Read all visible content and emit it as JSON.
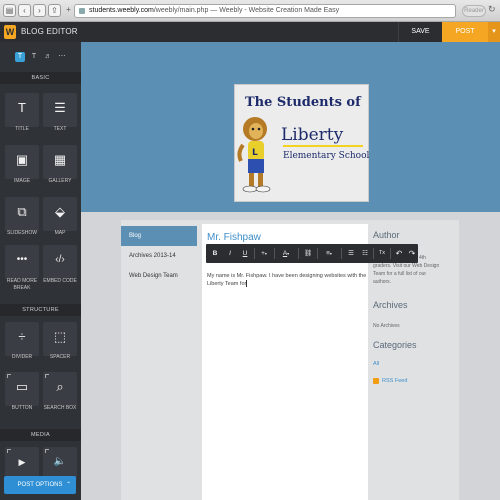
{
  "browser": {
    "url_host": "students.weebly.com",
    "url_path": "/weebly/main.php — Weebly - Website Creation Made Easy",
    "reader_label": "Reader"
  },
  "topbar": {
    "logo_letter": "W",
    "title": "BLOG EDITOR",
    "save_label": "SAVE",
    "post_label": "POST",
    "post_caret": "▾"
  },
  "sidebar": {
    "tabs": [
      {
        "label": "T",
        "active": true
      },
      {
        "label": "T",
        "active": false
      },
      {
        "label": "♬",
        "active": false
      },
      {
        "label": "⋯",
        "active": false
      }
    ],
    "sections": {
      "basic": "BASIC",
      "structure": "STRUCTURE",
      "media": "MEDIA"
    },
    "elements": [
      {
        "label": "TITLE",
        "icon": "T"
      },
      {
        "label": "TEXT",
        "icon": "☰"
      },
      {
        "label": "IMAGE",
        "icon": "▣"
      },
      {
        "label": "GALLERY",
        "icon": "▦"
      },
      {
        "label": "SLIDESHOW",
        "icon": "⧉"
      },
      {
        "label": "MAP",
        "icon": "⬙"
      },
      {
        "label": "READ MORE BREAK",
        "icon": "•••"
      },
      {
        "label": "EMBED CODE",
        "icon": "‹/›"
      },
      {
        "label": "DIVIDER",
        "icon": "÷"
      },
      {
        "label": "SPACER",
        "icon": "⬚"
      },
      {
        "label": "BUTTON",
        "icon": "▭"
      },
      {
        "label": "SEARCH BOX",
        "icon": "⌕"
      },
      {
        "label": "",
        "icon": "▶"
      },
      {
        "label": "",
        "icon": "🔈"
      }
    ],
    "post_options_label": "POST OPTIONS",
    "post_options_chevron": "⌃"
  },
  "site": {
    "banner": {
      "line1": "The Students of",
      "line2": "Liberty",
      "line3": "Elementary School"
    },
    "nav": [
      {
        "label": "Blog",
        "active": true
      },
      {
        "label": "Archives 2013-14",
        "active": false
      },
      {
        "label": "Web Design Team",
        "active": false
      }
    ],
    "post": {
      "title": "Mr. Fishpaw",
      "body": "My name is Mr. Fishpaw. I have been designing websites with the Liberty Team for"
    },
    "sidebar": {
      "author_heading": "Author",
      "author_text_top": "4th",
      "author_text": "graders. Visit our Web Design Team for a full list of our authors.",
      "archives_heading": "Archives",
      "archives_text": "No Archives",
      "categories_heading": "Categories",
      "categories_all": "All",
      "rss_label": "RSS Feed"
    }
  },
  "toolbar": {
    "bold": "B",
    "italic": "I",
    "underline": "U",
    "add": "+",
    "add_arrow": "▾",
    "font_color": "A",
    "color_arrow": "▾",
    "link": "⛓",
    "align": "≡",
    "align_arrow": "▾",
    "list": "☰",
    "numbered_list": "☷",
    "clear_format": "Tx",
    "undo": "↶",
    "redo": "↷"
  },
  "colors": {
    "accent_orange": "#f5a623",
    "header_blue": "#5b8fb3",
    "link_blue": "#3f8ec9",
    "sidebar_dark": "#2f3237"
  }
}
